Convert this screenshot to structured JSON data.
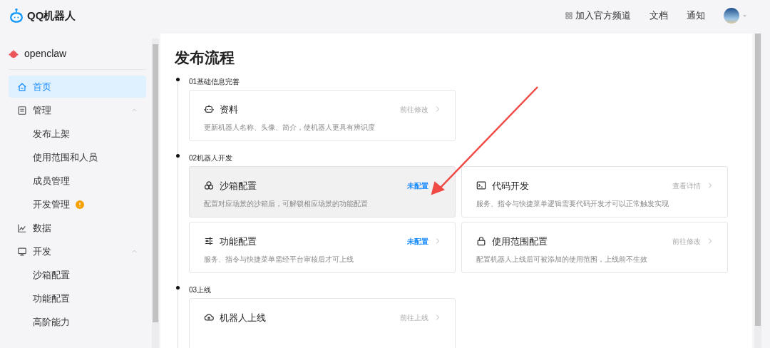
{
  "header": {
    "brand": "QQ机器人",
    "links": [
      {
        "label": "加入官方频道",
        "kind": "grid"
      },
      {
        "label": "文档",
        "kind": "plain"
      },
      {
        "label": "通知",
        "kind": "plain"
      }
    ]
  },
  "sidebar": {
    "bot_name": "openclaw",
    "items": [
      {
        "label": "首页",
        "selected": true
      },
      {
        "label": "管理",
        "selected": false,
        "expanded": true,
        "children": [
          {
            "label": "发布上架",
            "selected": false
          },
          {
            "label": "使用范围和人员",
            "selected": false
          },
          {
            "label": "成员管理",
            "selected": false
          },
          {
            "label": "开发管理",
            "selected": false,
            "warning": true
          }
        ]
      },
      {
        "label": "数据",
        "selected": false
      },
      {
        "label": "开发",
        "selected": false,
        "expanded": true,
        "children": [
          {
            "label": "沙箱配置",
            "selected": false
          },
          {
            "label": "功能配置",
            "selected": false
          },
          {
            "label": "高阶能力",
            "selected": false
          }
        ]
      }
    ]
  },
  "page": {
    "title": "发布流程",
    "sections": [
      {
        "label": "01基础信息完善",
        "cards": [
          {
            "title": "资料",
            "description": "更新机器人名称、头像、简介，使机器人更具有辨识度",
            "action": "前往修改",
            "pending": false,
            "hovered": false
          }
        ]
      },
      {
        "label": "02机器人开发",
        "cards": [
          {
            "title": "沙箱配置",
            "description": "配置对应场景的沙箱后，可解锁相应场景的功能配置",
            "action": "未配置",
            "pending": true,
            "hovered": true
          },
          {
            "title": "代码开发",
            "description": "服务、指令与快捷菜单逻辑需要代码开发才可以正常触发实现",
            "action": "查看详情",
            "pending": false,
            "hovered": false
          },
          {
            "title": "功能配置",
            "description": "服务、指令与快捷菜单需经平台审核后才可上线",
            "action": "未配置",
            "pending": true,
            "hovered": false
          },
          {
            "title": "使用范围配置",
            "description": "配置机器人上线后可被添加的使用范围，上线前不生效",
            "action": "前往修改",
            "pending": false,
            "hovered": false
          }
        ]
      },
      {
        "label": "03上线",
        "cards": [
          {
            "title": "机器人上线",
            "action": "前往上线",
            "pending": false,
            "hovered": false
          }
        ]
      }
    ]
  }
}
